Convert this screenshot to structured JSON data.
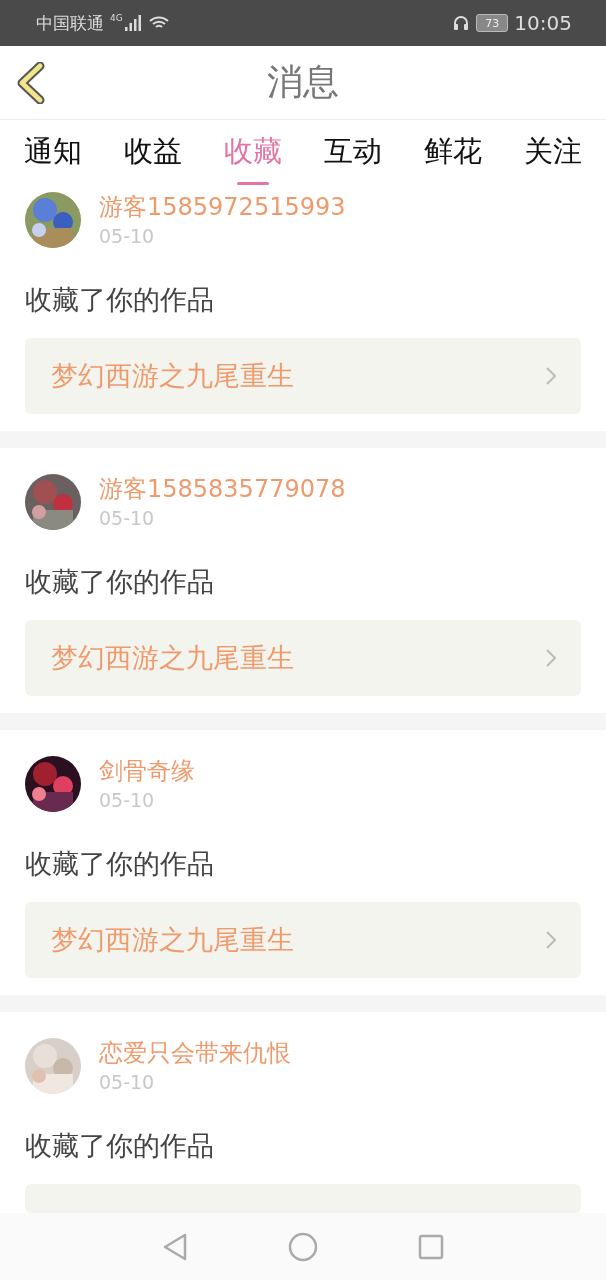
{
  "status_bar": {
    "carrier": "中国联通",
    "network": "4G",
    "battery": "73",
    "time": "10:05"
  },
  "header": {
    "title": "消息"
  },
  "tabs": [
    {
      "label": "通知",
      "selected": false
    },
    {
      "label": "收益",
      "selected": false
    },
    {
      "label": "收藏",
      "selected": true
    },
    {
      "label": "互动",
      "selected": false
    },
    {
      "label": "鲜花",
      "selected": false
    },
    {
      "label": "关注",
      "selected": false
    }
  ],
  "messages": [
    {
      "user": "游客1585972515993",
      "date": "05-10",
      "text": "收藏了你的作品",
      "work": "梦幻西游之九尾重生"
    },
    {
      "user": "游客1585835779078",
      "date": "05-10",
      "text": "收藏了你的作品",
      "work": "梦幻西游之九尾重生"
    },
    {
      "user": "剑骨奇缘",
      "date": "05-10",
      "text": "收藏了你的作品",
      "work": "梦幻西游之九尾重生"
    },
    {
      "user": "恋爱只会带来仇恨",
      "date": "05-10",
      "text": "收藏了你的作品"
    }
  ]
}
